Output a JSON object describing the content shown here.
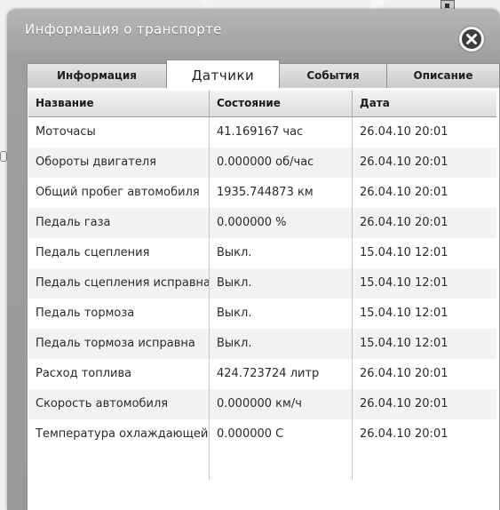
{
  "window": {
    "title": "Информация о транспорте"
  },
  "tabs": [
    {
      "label": "Информация",
      "active": false
    },
    {
      "label": "Датчики",
      "active": true
    },
    {
      "label": "События",
      "active": false
    },
    {
      "label": "Описание",
      "active": false
    }
  ],
  "table": {
    "columns": [
      "Название",
      "Состояние",
      "Дата"
    ],
    "rows": [
      {
        "name": "Моточасы",
        "state": "41.169167 час",
        "date": "26.04.10 20:01"
      },
      {
        "name": "Обороты двигателя",
        "state": "0.000000 об/час",
        "date": "26.04.10 20:01"
      },
      {
        "name": "Общий пробег автомобиля",
        "state": "1935.744873 км",
        "date": "26.04.10 20:01"
      },
      {
        "name": "Педаль газа",
        "state": "0.000000 %",
        "date": "26.04.10 20:01"
      },
      {
        "name": "Педаль сцепления",
        "state": "Выкл.",
        "date": "15.04.10 12:01"
      },
      {
        "name": "Педаль сцепления исправна",
        "state": "Выкл.",
        "date": "15.04.10 12:01"
      },
      {
        "name": "Педаль тормоза",
        "state": "Выкл.",
        "date": "15.04.10 12:01"
      },
      {
        "name": "Педаль тормоза исправна",
        "state": "Выкл.",
        "date": "15.04.10 12:01"
      },
      {
        "name": "Расход топлива",
        "state": "424.723724 литр",
        "date": "26.04.10 20:01"
      },
      {
        "name": "Скорость автомобиля",
        "state": "0.000000 км/ч",
        "date": "26.04.10 20:01"
      },
      {
        "name": "Температура охлаждающей жидкости",
        "state": "0.000000 С",
        "date": "26.04.10 20:01"
      }
    ]
  },
  "icons": {
    "close": "close-icon"
  }
}
